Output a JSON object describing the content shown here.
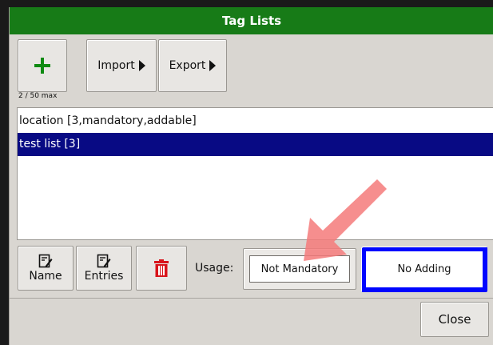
{
  "dialog": {
    "title": "Tag Lists"
  },
  "toolbar": {
    "add_icon": "plus-icon",
    "import_label": "Import",
    "export_label": "Export",
    "count_text": "2 / 50 max"
  },
  "list": {
    "items": [
      {
        "label": "location [3,mandatory,addable]",
        "selected": false
      },
      {
        "label": "test list [3]",
        "selected": true
      }
    ]
  },
  "actions": {
    "name_label": "Name",
    "entries_label": "Entries",
    "delete_icon": "trash-icon",
    "usage_label": "Usage:",
    "usage_value": "Not Mandatory",
    "adding_value": "No Adding",
    "close_label": "Close"
  },
  "colors": {
    "title_bar": "#177b17",
    "selection": "#080a84",
    "adding_highlight": "#0006ff",
    "delete_icon": "#d8141b",
    "arrow_overlay": "#f47a7a"
  }
}
